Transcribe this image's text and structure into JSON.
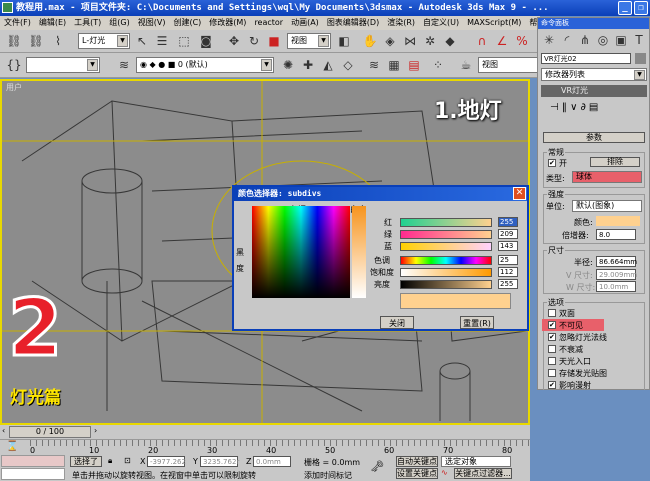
{
  "window": {
    "title": "教程用.max    - 项目文件夹: C:\\Documents and Settings\\wql\\My Documents\\3dsmax    - Autodesk 3ds Max 9   - ..."
  },
  "menu": [
    "文件(F)",
    "编辑(E)",
    "工具(T)",
    "组(G)",
    "视图(V)",
    "创建(C)",
    "修改器(M)",
    "reactor",
    "动画(A)",
    "图表编辑器(D)",
    "渲染(R)",
    "自定义(U)",
    "MAXScript(M)",
    "帮助(H)"
  ],
  "toolbar": {
    "selection_filter": "L-灯光",
    "ref_coord": "视图",
    "layer": "0 (默认)",
    "named_sel": "",
    "view2": "视图"
  },
  "viewport": {
    "label": "用户",
    "overlay_title": "1.地灯",
    "big_number": "2",
    "subtitle": "灯光篇"
  },
  "color_dialog": {
    "title": "颜色选择器: subdivs",
    "hue_label": "色调",
    "whiteness_label": "白度",
    "blackness_label": "黑度",
    "channels": [
      {
        "label": "红",
        "value": "255"
      },
      {
        "label": "绿",
        "value": "209"
      },
      {
        "label": "蓝",
        "value": "143"
      },
      {
        "label": "色调",
        "value": "25"
      },
      {
        "label": "饱和度",
        "value": "112"
      },
      {
        "label": "亮度",
        "value": "255"
      }
    ],
    "swatch": "#ffd18f",
    "close": "关闭",
    "reset": "重置(R)"
  },
  "command_panel": {
    "title": "命令面板",
    "object_name": "VR灯光02",
    "modifier_list": "修改器列表",
    "stack_item": "VR灯光",
    "rollout": "参数",
    "general": "常规",
    "on_label": "开",
    "exclude": "排除",
    "type_label": "类型:",
    "type_value": "球体",
    "intensity": "强度",
    "units_label": "单位:",
    "units_value": "默认(图象)",
    "color_label": "颜色:",
    "color": "#ffd18f",
    "multiplier_label": "倍增器:",
    "multiplier": "8.0",
    "size": "尺寸",
    "radius_label": "半径:",
    "radius": "86.664mm",
    "usize_label": "V 尺寸:",
    "usize": "29.009mm",
    "vsize_label": "W 尺寸:",
    "vsize": "10.0mm",
    "options": "选项",
    "opts": [
      {
        "label": "双面",
        "checked": false
      },
      {
        "label": "不可见",
        "checked": true
      },
      {
        "label": "忽略灯光法线",
        "checked": true
      },
      {
        "label": "不衰减",
        "checked": false
      },
      {
        "label": "天光入口",
        "checked": false
      },
      {
        "label": "存储发光贴图",
        "checked": false
      },
      {
        "label": "影响漫射",
        "checked": true
      }
    ]
  },
  "timeline": {
    "frame": "0 / 100",
    "ticks": [
      "0",
      "10",
      "20",
      "30",
      "40",
      "50",
      "60",
      "70",
      "80"
    ]
  },
  "status": {
    "selected": "选择了",
    "x": "-3977.262",
    "y": "3235.762r",
    "z": "0.0mm",
    "grid": "栅格 = 0.0mm",
    "auto_key": "自动关键点",
    "set_key": "设置关键点",
    "sel_obj": "选定对象",
    "key_filters": "关键点过滤器...",
    "prompt": "单击并拖动以旋转视图。在视窗中单击可以限制旋转",
    "add_time_tag": "添加时间标记"
  }
}
